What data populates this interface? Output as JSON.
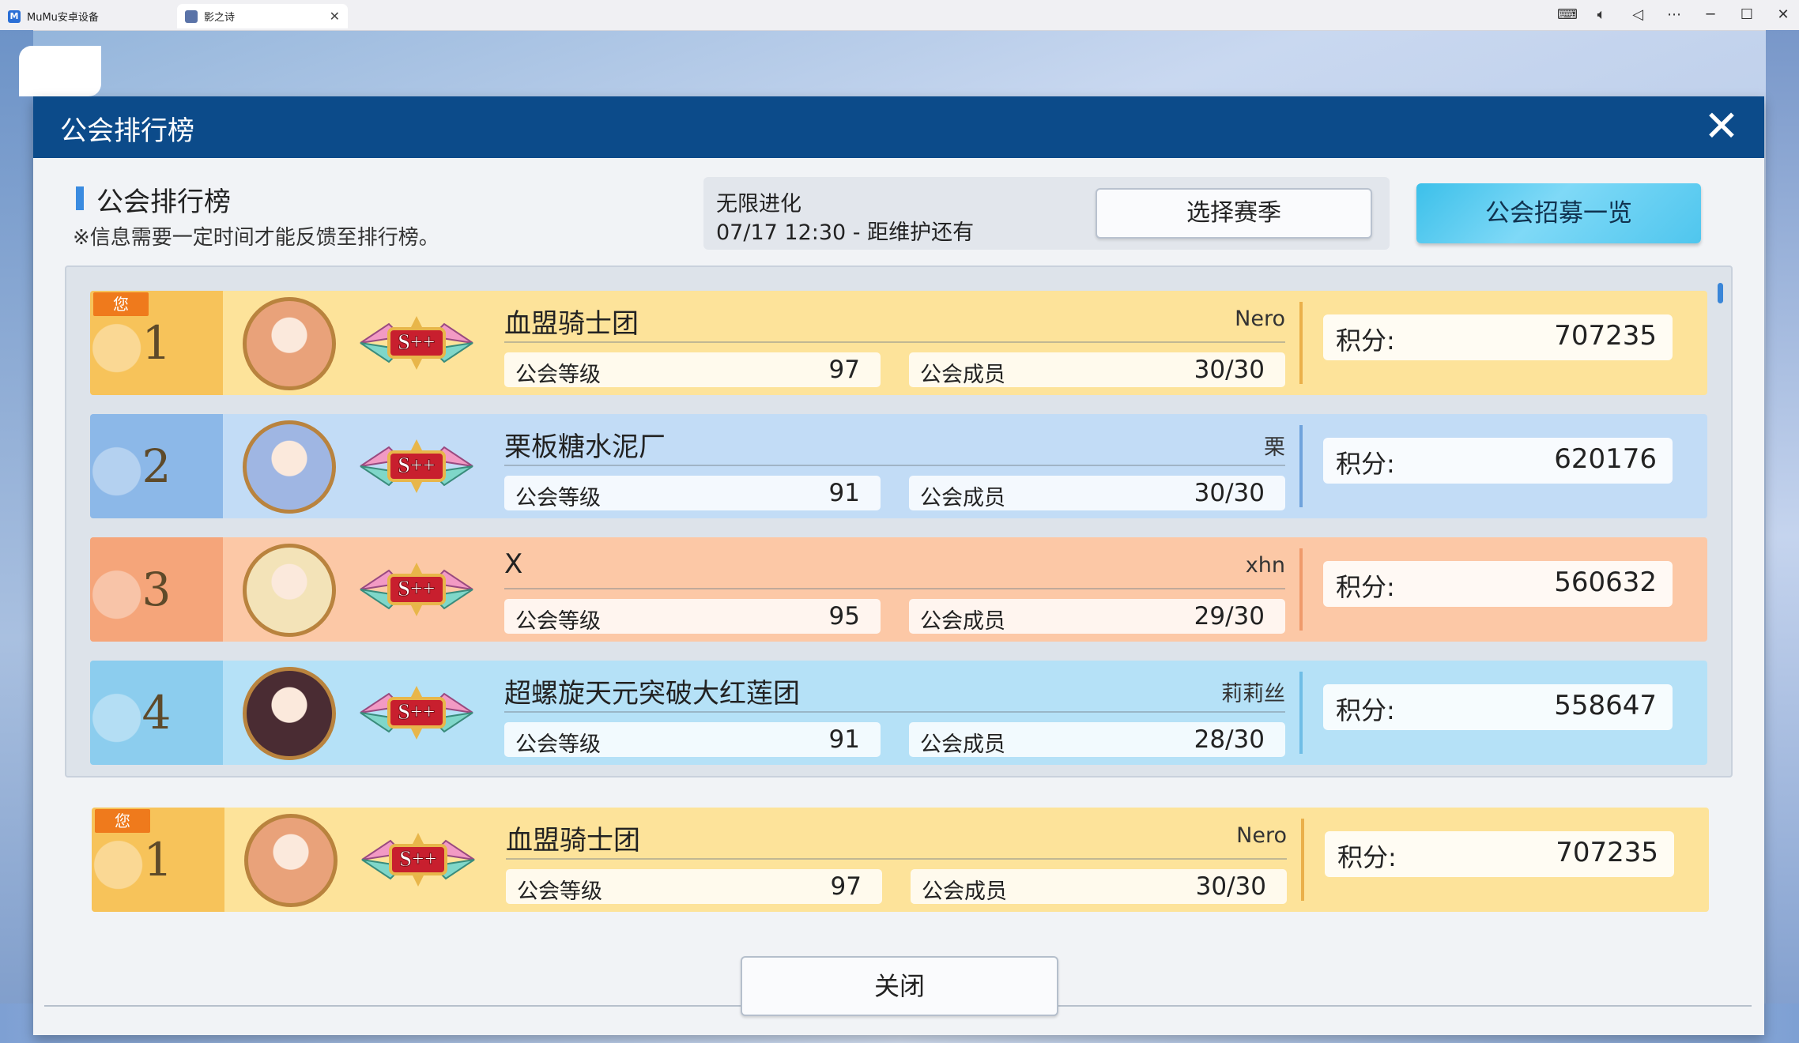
{
  "window": {
    "tabs": [
      {
        "label": "MuMu安卓设备",
        "icon": "mumu-icon"
      },
      {
        "label": "影之诗",
        "icon": "game-icon"
      }
    ],
    "controls": [
      "keyboard-icon",
      "volume-icon",
      "back-triangle-icon",
      "more-icon",
      "minimize-icon",
      "maximize-icon",
      "close-icon"
    ]
  },
  "dialog": {
    "title": "公会排行榜",
    "section_title": "公会排行榜",
    "note": "※信息需要一定时间才能反馈至排行榜。",
    "season": {
      "name": "无限进化",
      "schedule": "07/17 12:30 - 距维护还有",
      "select_button": "选择赛季"
    },
    "recruit_button": "公会招募一览",
    "close_button": "关闭"
  },
  "labels": {
    "guild_level": "公会等级",
    "guild_members": "公会成员",
    "score": "积分:",
    "you": "您"
  },
  "rankings": [
    {
      "rank": "1",
      "name": "血盟骑士团",
      "leader": "Nero",
      "level": "97",
      "members": "30/30",
      "score": "707235",
      "grade": "S++",
      "theme": "gold",
      "is_you": true
    },
    {
      "rank": "2",
      "name": "栗板糖水泥厂",
      "leader": "栗",
      "level": "91",
      "members": "30/30",
      "score": "620176",
      "grade": "S++",
      "theme": "blue",
      "is_you": false
    },
    {
      "rank": "3",
      "name": "X",
      "leader": "xhn",
      "level": "95",
      "members": "29/30",
      "score": "560632",
      "grade": "S++",
      "theme": "orange",
      "is_you": false
    },
    {
      "rank": "4",
      "name": "超螺旋天元突破大红莲团",
      "leader": "莉莉丝",
      "level": "91",
      "members": "28/30",
      "score": "558647",
      "grade": "S++",
      "theme": "sky",
      "is_you": false
    }
  ],
  "my_guild": {
    "rank": "1",
    "name": "血盟骑士团",
    "leader": "Nero",
    "level": "97",
    "members": "30/30",
    "score": "707235",
    "grade": "S++",
    "theme": "gold",
    "is_you": true
  },
  "colors": {
    "header": "#0c4b8a",
    "gold_row": "#fde39a",
    "gold_rank": "#f7c35a",
    "blue_row": "#c2dcf6",
    "blue_rank": "#8cb8e8",
    "orange_row": "#fcc8a6",
    "orange_rank": "#f5a57a",
    "sky_row": "#b5e1f7",
    "sky_rank": "#8ccdee"
  }
}
